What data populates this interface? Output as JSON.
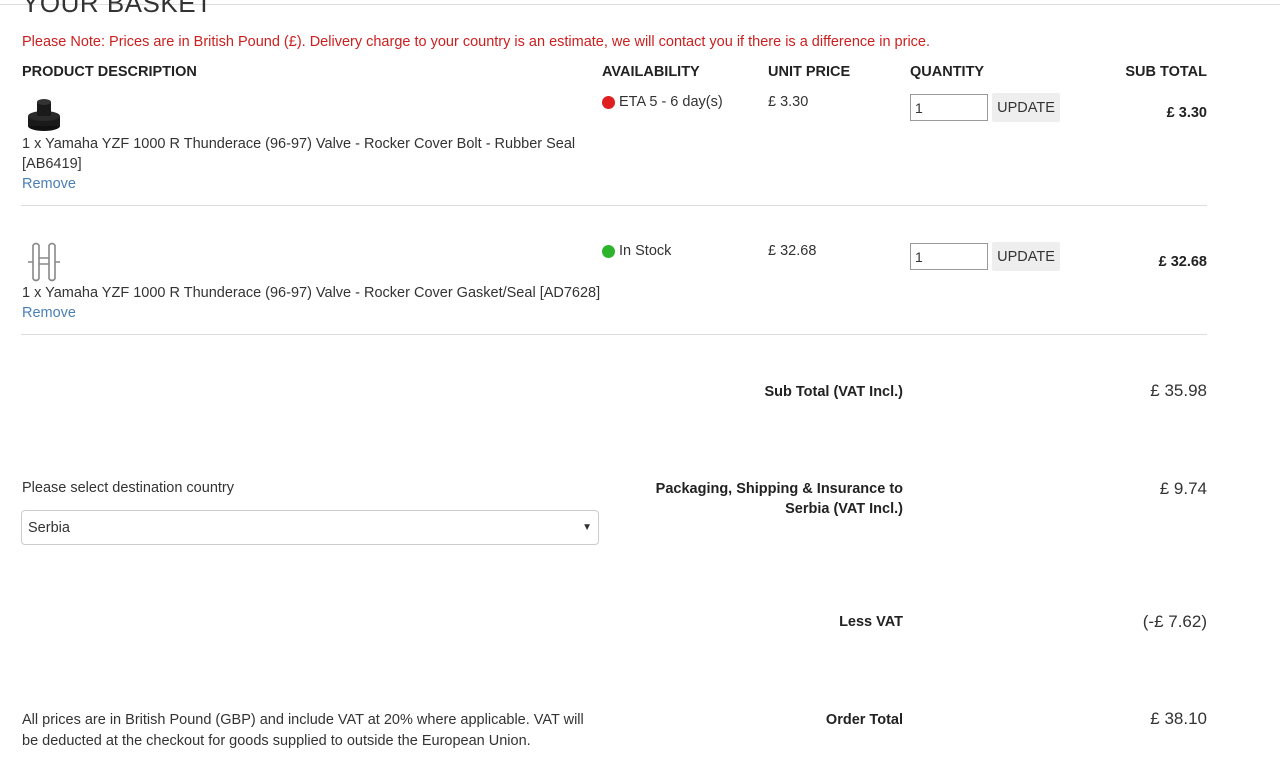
{
  "page": {
    "title": "YOUR BASKET",
    "note": "Please Note: Prices are in British Pound (£). Delivery charge to your country is an estimate, we will contact you if there is a difference in price."
  },
  "table": {
    "headers": {
      "product": "PRODUCT DESCRIPTION",
      "availability": "AVAILABILITY",
      "unit_price": "UNIT PRICE",
      "quantity": "QUANTITY",
      "sub_total": "SUB TOTAL"
    },
    "items": [
      {
        "description": "1 x Yamaha YZF 1000 R Thunderace (96-97) Valve - Rocker Cover Bolt - Rubber Seal [AB6419]",
        "remove": "Remove",
        "availability": "ETA 5 - 6 day(s)",
        "availability_color": "#e02020",
        "unit_price": "£ 3.30",
        "quantity": "1",
        "update": "UPDATE",
        "sub_total": "£ 3.30",
        "icon": "rubber-seal-icon"
      },
      {
        "description": "1 x Yamaha YZF 1000 R Thunderace (96-97) Valve - Rocker Cover Gasket/Seal [AD7628]",
        "remove": "Remove",
        "availability": "In Stock",
        "availability_color": "#2cb52c",
        "unit_price": "£ 32.68",
        "quantity": "1",
        "update": "UPDATE",
        "sub_total": "£ 32.68",
        "icon": "gasket-icon"
      }
    ]
  },
  "summary": {
    "sub_total_label": "Sub Total (VAT Incl.)",
    "sub_total_value": "£ 35.98",
    "shipping_label_1": "Packaging, Shipping & Insurance to",
    "shipping_label_2": "Serbia (VAT Incl.)",
    "shipping_value": "£ 9.74",
    "less_vat_label": "Less VAT",
    "less_vat_value": "(-£ 7.62)",
    "order_total_label": "Order Total",
    "order_total_value": "£ 38.10"
  },
  "destination": {
    "label": "Please select destination country",
    "selected": "Serbia"
  },
  "footnote": "All prices are in British Pound (GBP) and include VAT at 20% where applicable. VAT will be deducted at the checkout for goods supplied to outside the European Union.",
  "colors": {
    "note_red": "#cc1f1f",
    "link_blue": "#4a7fb5"
  }
}
